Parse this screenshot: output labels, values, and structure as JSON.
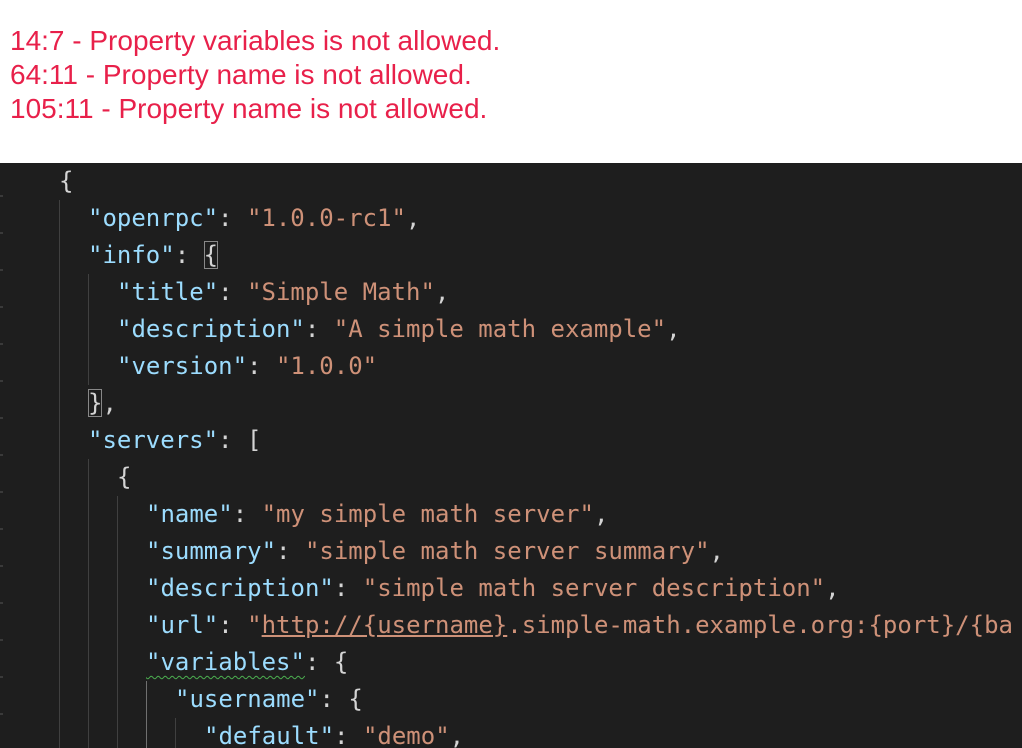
{
  "errors": [
    "14:7 - Property variables is not allowed.",
    "64:11 - Property name is not allowed.",
    "105:11 - Property name is not allowed."
  ],
  "colors": {
    "error_text": "#e8204a",
    "editor_bg": "#1e1e1e",
    "key": "#9cdcfe",
    "string": "#ce9178",
    "punctuation": "#d4d4d4",
    "warning_squiggle": "#4caf50"
  },
  "code": {
    "l1": {
      "open": "{"
    },
    "l2": {
      "key": "\"openrpc\"",
      "colon": ": ",
      "value": "\"1.0.0-rc1\"",
      "end": ","
    },
    "l3": {
      "key": "\"info\"",
      "colon": ": ",
      "open": "{"
    },
    "l4": {
      "key": "\"title\"",
      "colon": ": ",
      "value": "\"Simple Math\"",
      "end": ","
    },
    "l5": {
      "key": "\"description\"",
      "colon": ": ",
      "value": "\"A simple math example\"",
      "end": ","
    },
    "l6": {
      "key": "\"version\"",
      "colon": ": ",
      "value": "\"1.0.0\""
    },
    "l7": {
      "close": "}",
      "end": ","
    },
    "l8": {
      "key": "\"servers\"",
      "colon": ": ",
      "open": "["
    },
    "l9": {
      "open": "{"
    },
    "l10": {
      "key": "\"name\"",
      "colon": ": ",
      "value": "\"my simple math server\"",
      "end": ","
    },
    "l11": {
      "key": "\"summary\"",
      "colon": ": ",
      "value": "\"simple math server summary\"",
      "end": ","
    },
    "l12": {
      "key": "\"description\"",
      "colon": ": ",
      "value": "\"simple math server description\"",
      "end": ","
    },
    "l13": {
      "key": "\"url\"",
      "colon": ": ",
      "q": "\"",
      "link": "http://{username}",
      "rest": ".simple-math.example.org:{port}/{ba"
    },
    "l14": {
      "key": "\"variables\"",
      "colon": ": ",
      "open": "{"
    },
    "l15": {
      "key": "\"username\"",
      "colon": ": ",
      "open": "{"
    },
    "l16": {
      "key": "\"default\"",
      "colon": ": ",
      "value": "\"demo\"",
      "end": ","
    }
  }
}
